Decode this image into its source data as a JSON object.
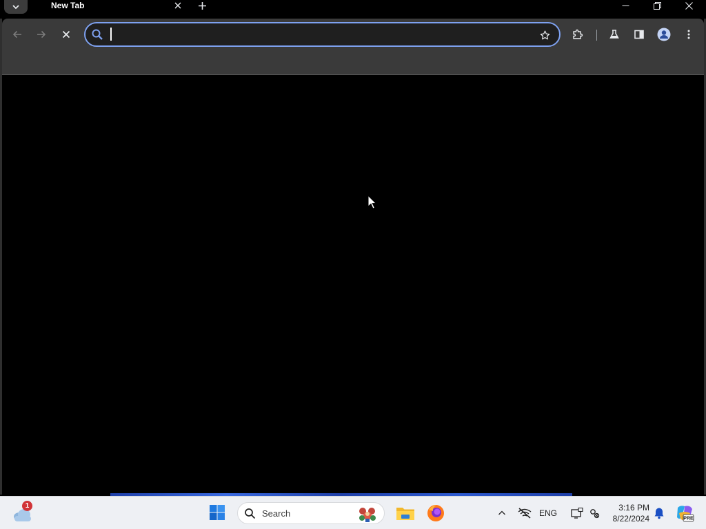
{
  "browser": {
    "tab": {
      "title": "New Tab"
    },
    "omnibox": {
      "value": "",
      "placeholder": ""
    }
  },
  "taskbar": {
    "weather_badge": "1",
    "search_label": "Search",
    "language": "ENG",
    "time": "3:16 PM",
    "date": "8/22/2024"
  },
  "icons": {
    "tab_search": "chevron-down-icon",
    "tab_close": "close-icon",
    "new_tab": "plus-icon",
    "back": "arrow-left-icon",
    "forward": "arrow-right-icon",
    "stop": "close-icon",
    "omnibox": "search-icon",
    "bookmark": "star-icon",
    "extensions": "puzzle-icon",
    "labs": "flask-icon",
    "side_panel": "side-panel-icon",
    "profile": "avatar-icon",
    "menu": "kebab-menu-icon"
  },
  "colors": {
    "toolbar": "#3a3a3a",
    "omnibox_focus_ring": "#7ea1f0",
    "content": "#000000",
    "taskbar": "#eef0f4"
  }
}
